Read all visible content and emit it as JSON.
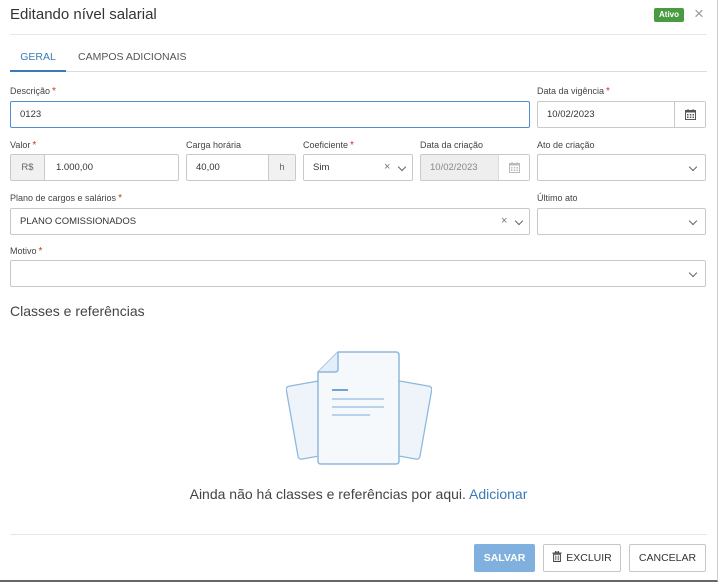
{
  "header": {
    "title": "Editando nível salarial",
    "status": "Ativo",
    "status_color": "#4a9a42",
    "close_icon": "×"
  },
  "tabs": [
    {
      "label": "GERAL",
      "active": true
    },
    {
      "label": "CAMPOS ADICIONAIS",
      "active": false
    }
  ],
  "form": {
    "descricao": {
      "label": "Descrição",
      "required": "*",
      "value": "0123"
    },
    "data_vigencia": {
      "label": "Data da vigência",
      "required": "*",
      "value": "10/02/2023"
    },
    "valor": {
      "label": "Valor",
      "required": "*",
      "prefix": "R$",
      "value": "1.000,00"
    },
    "carga_horaria": {
      "label": "Carga horária",
      "value": "40,00",
      "suffix": "h"
    },
    "coeficiente": {
      "label": "Coeficiente",
      "required": "*",
      "value": "Sim"
    },
    "data_criacao": {
      "label": "Data da criação",
      "value": "10/02/2023"
    },
    "ato_criacao": {
      "label": "Ato de criação",
      "value": ""
    },
    "plano_cargos": {
      "label": "Plano de cargos e salários",
      "required": "*",
      "value": "PLANO COMISSIONADOS"
    },
    "ultimo_ato": {
      "label": "Último ato",
      "value": ""
    },
    "motivo": {
      "label": "Motivo",
      "required": "*",
      "value": ""
    }
  },
  "classes": {
    "title": "Classes e referências",
    "empty_text": "Ainda não há classes e referências por aqui.",
    "add_link": "Adicionar"
  },
  "footer": {
    "save_label": "SALVAR",
    "delete_label": "EXCLUIR",
    "cancel_label": "CANCELAR"
  },
  "colors": {
    "accent": "#3a7ab8",
    "primary_button": "#7fb0de",
    "required": "#c0392b"
  }
}
